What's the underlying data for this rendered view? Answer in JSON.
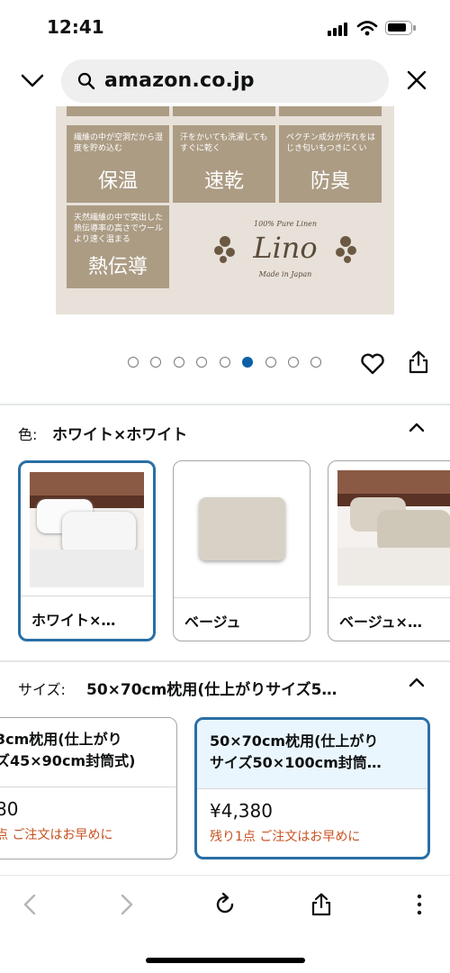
{
  "status_bar": {
    "time": "12:41"
  },
  "url_bar": {
    "url": "amazon.co.jp"
  },
  "product_image": {
    "tiles": [
      {
        "small": "繊維の中が空洞だから湿度を貯め込む",
        "big": "保温"
      },
      {
        "small": "汗をかいても洗濯してもすぐに乾く",
        "big": "速乾"
      },
      {
        "small": "ペクチン成分が汚れをはじき匂いもつきにくい",
        "big": "防臭"
      },
      {
        "small": "天然繊維の中で突出した熱伝導率の高さでウールより速く温まる",
        "big": "熱伝導"
      }
    ],
    "logo": {
      "top": "100% Pure Linen",
      "name": "Lino",
      "bottom": "Made in Japan"
    }
  },
  "carousel": {
    "count": 9,
    "active_index": 5
  },
  "color_section": {
    "label": "色:",
    "value": "ホワイト×ホワイト",
    "options": [
      {
        "label": "ホワイト×…",
        "selected": true
      },
      {
        "label": "ベージュ",
        "selected": false
      },
      {
        "label": "ベージュ×…",
        "selected": false
      }
    ]
  },
  "size_section": {
    "label": "サイズ:",
    "value": "50×70cm枕用(仕上がりサイズ5…",
    "options": [
      {
        "line1": "3cm枕用(仕上がり",
        "line2": "ズ45×90cm封筒式)",
        "price": "80",
        "stock": "点 ご注文はお早めに",
        "selected": false
      },
      {
        "line1": "50×70cm枕用(仕上がり",
        "line2": "サイズ50×100cm封筒…",
        "price": "¥4,380",
        "stock": "残り1点 ご注文はお早めに",
        "selected": true
      }
    ]
  },
  "colors": {
    "accent": "#2a6fa5",
    "active_dot": "#0d5fa8",
    "stock_red": "#c7511f",
    "tile": "#ac9c84"
  }
}
